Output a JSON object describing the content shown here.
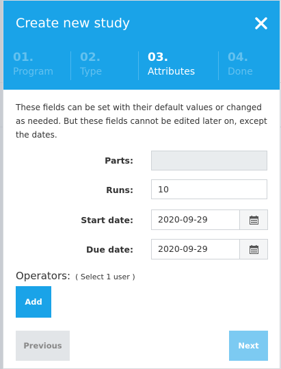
{
  "modal": {
    "title": "Create new study",
    "close_icon": "close-icon"
  },
  "steps": [
    {
      "num": "01.",
      "label": "Program",
      "active": false
    },
    {
      "num": "02.",
      "label": "Type",
      "active": false
    },
    {
      "num": "03.",
      "label": "Attributes",
      "active": true
    },
    {
      "num": "04.",
      "label": "Done",
      "active": false
    }
  ],
  "intro": "These fields can be set with their default values or changed as needed. But these fields cannot be edited later on, except the dates.",
  "fields": {
    "parts": {
      "label": "Parts:",
      "value": ""
    },
    "runs": {
      "label": "Runs:",
      "value": "10"
    },
    "start_date": {
      "label": "Start date:",
      "value": "2020-09-29",
      "icon": "calendar-icon"
    },
    "due_date": {
      "label": "Due date:",
      "value": "2020-09-29",
      "icon": "calendar-icon"
    }
  },
  "operators": {
    "label": "Operators:",
    "hint": "( Select 1 user )",
    "add_label": "Add"
  },
  "footer": {
    "previous_label": "Previous",
    "next_label": "Next"
  },
  "colors": {
    "accent": "#1aa3e8",
    "step_inactive": "#63c1ef",
    "next_disabled": "#7ccaf2",
    "prev_bg": "#e2e5e8"
  }
}
